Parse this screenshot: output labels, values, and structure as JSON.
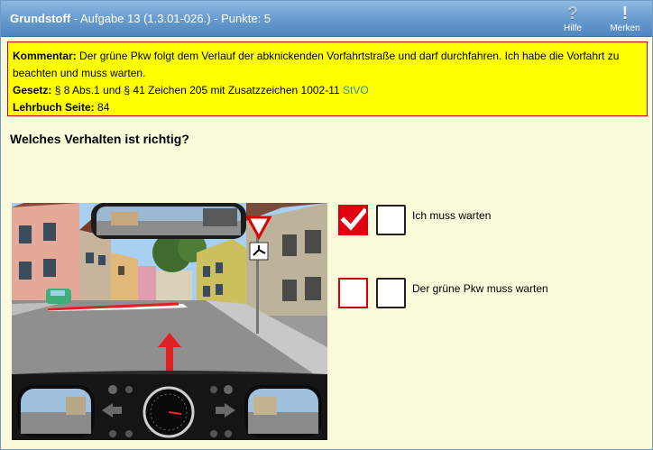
{
  "header": {
    "category": "Grundstoff",
    "task_info": " - Aufgabe 13 (1.3.01-026.) - Punkte: 5",
    "help_label": "Hilfe",
    "help_glyph": "?",
    "bookmark_label": "Merken",
    "bookmark_glyph": "!"
  },
  "comment": {
    "kommentar_label": "Kommentar:",
    "kommentar_text": " Der grüne Pkw folgt dem Verlauf der abknickenden Vorfahrtstraße und darf durchfahren. Ich habe die Vorfahrt zu beachten und muss warten.",
    "gesetz_label": "Gesetz:",
    "gesetz_text": " § 8 Abs.1 und § 41 Zeichen 205 mit Zusatzzeichen 1002-11 ",
    "gesetz_link": "StVO",
    "lehrbuch_label": "Lehrbuch Seite:",
    "lehrbuch_page": " 84"
  },
  "question": "Welches Verhalten ist richtig?",
  "answers": [
    {
      "text": "Ich muss warten",
      "user_checked": true
    },
    {
      "text": "Der grüne Pkw muss warten",
      "user_checked": false
    }
  ],
  "colors": {
    "accent_red": "#e00010",
    "comment_bg": "#ffff00",
    "page_bg": "#fbfbdc",
    "title_bar": "#5b8fc8",
    "link": "#2a8fae"
  },
  "icons": {
    "help": "question-mark-icon",
    "bookmark": "exclamation-icon",
    "checked": "checkmark-icon"
  }
}
